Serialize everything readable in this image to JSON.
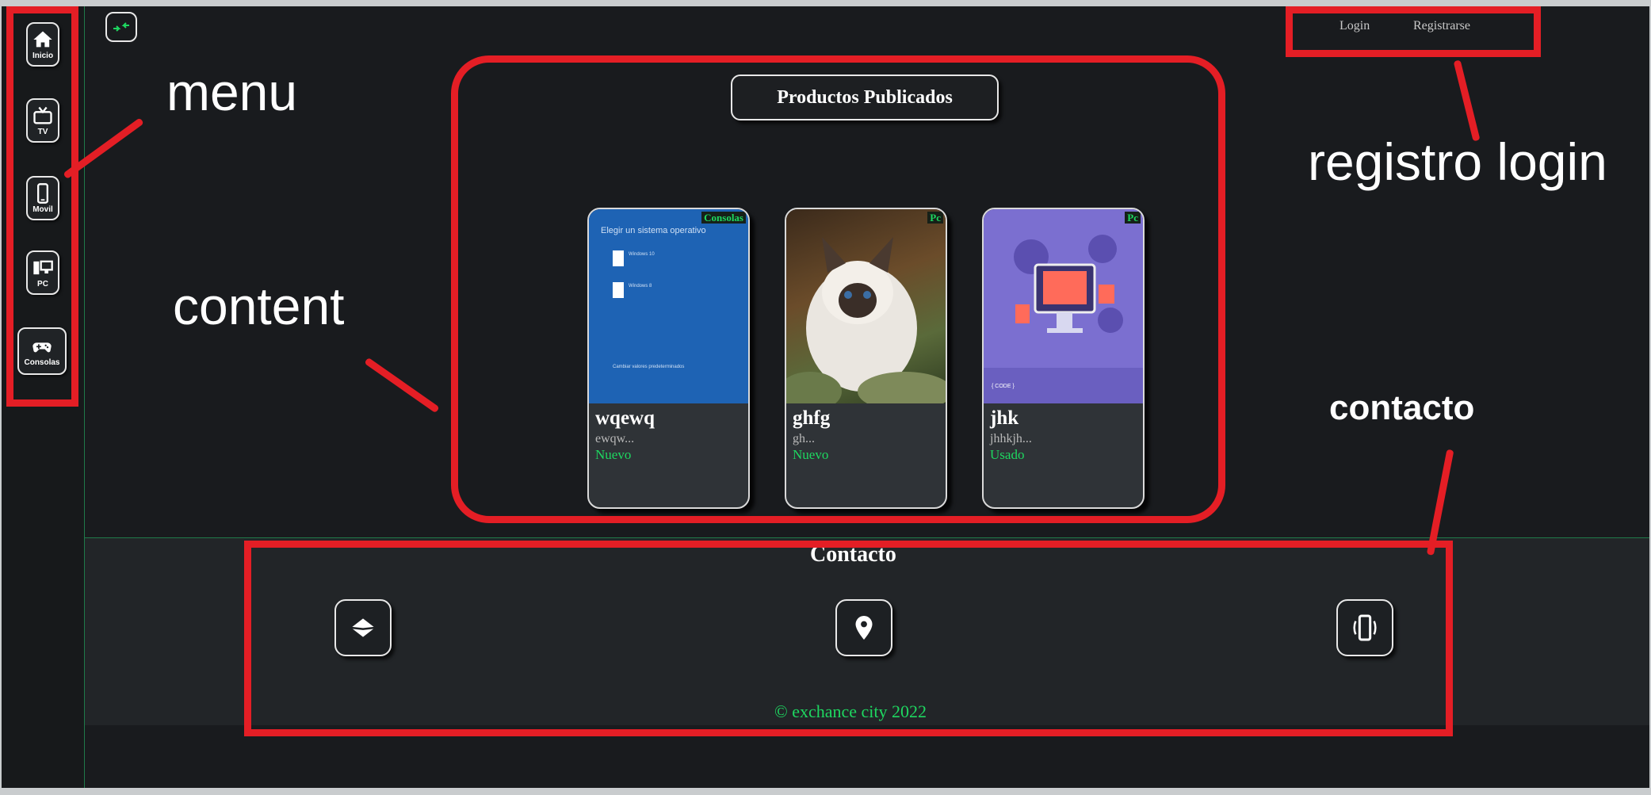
{
  "sidebar": {
    "items": [
      {
        "label": "Inicio",
        "icon": "home-icon"
      },
      {
        "label": "TV",
        "icon": "tv-icon"
      },
      {
        "label": "Movil",
        "icon": "mobile-icon"
      },
      {
        "label": "PC",
        "icon": "pc-icon"
      },
      {
        "label": "Consolas",
        "icon": "gamepad-icon",
        "active": true
      }
    ]
  },
  "header": {
    "collapse_icon": "collapse-arrows-icon",
    "login": "Login",
    "register": "Registrarse"
  },
  "main": {
    "title": "Productos Publicados",
    "products": [
      {
        "title": "wqewq",
        "desc": "ewqw...",
        "condition": "Nuevo",
        "category": "Consolas",
        "image": "windows-setup-screenshot"
      },
      {
        "title": "ghfg",
        "desc": "gh...",
        "condition": "Nuevo",
        "category": "Pc",
        "image": "cat-photo"
      },
      {
        "title": "jhk",
        "desc": "jhhkjh...",
        "condition": "Usado",
        "category": "Pc",
        "image": "developer-illustration"
      }
    ],
    "thumb_text": {
      "windows_header": "Elegir un sistema operativo",
      "windows_option_1": "Windows 10",
      "windows_option_2": "Windows 8",
      "windows_footer": "Cambiar valores predeterminados",
      "dev_side": "{ CODE }"
    }
  },
  "contact": {
    "title": "Contacto",
    "icons": [
      "mail-icon",
      "location-icon",
      "phone-icon"
    ],
    "copyright": "© exchance city 2022"
  },
  "annotations": {
    "menu": "menu",
    "content": "content",
    "registro_login": "registro login",
    "contacto": "contacto"
  },
  "colors": {
    "background": "#191b1e",
    "accent_green": "#1ed760",
    "annotation_red": "#e41e25",
    "contact_band": "#222528"
  }
}
